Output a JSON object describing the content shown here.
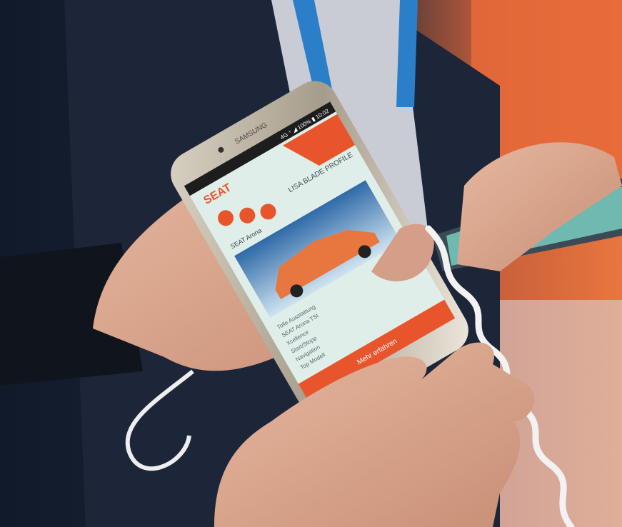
{
  "photo": {
    "subject": "Hands holding a display smartphone showing the SEAT app at a trade show"
  },
  "phone": {
    "brand_label": "SAMSUNG",
    "status_bar": "4G ⁺ ◢ 100% ▮ 10:02",
    "app": {
      "brand": "SEAT",
      "section_title": "LISA BLADE PROFILE",
      "car_caption": "SEAT Arona",
      "body_lines": [
        "Tolle Ausstattung",
        "SEAT Arona TSI",
        "Xcellence",
        "Start/Stopp",
        "Navigation",
        "Top Modell"
      ],
      "footer_button": "Mehr erfahren"
    }
  },
  "colors": {
    "app_accent": "#e8552c",
    "app_background": "#dfeee8",
    "jacket": "#1c2638",
    "backdrop_orange": "#e86a3a",
    "cable": "#f2f2f2",
    "skin": "#d9a48c"
  }
}
